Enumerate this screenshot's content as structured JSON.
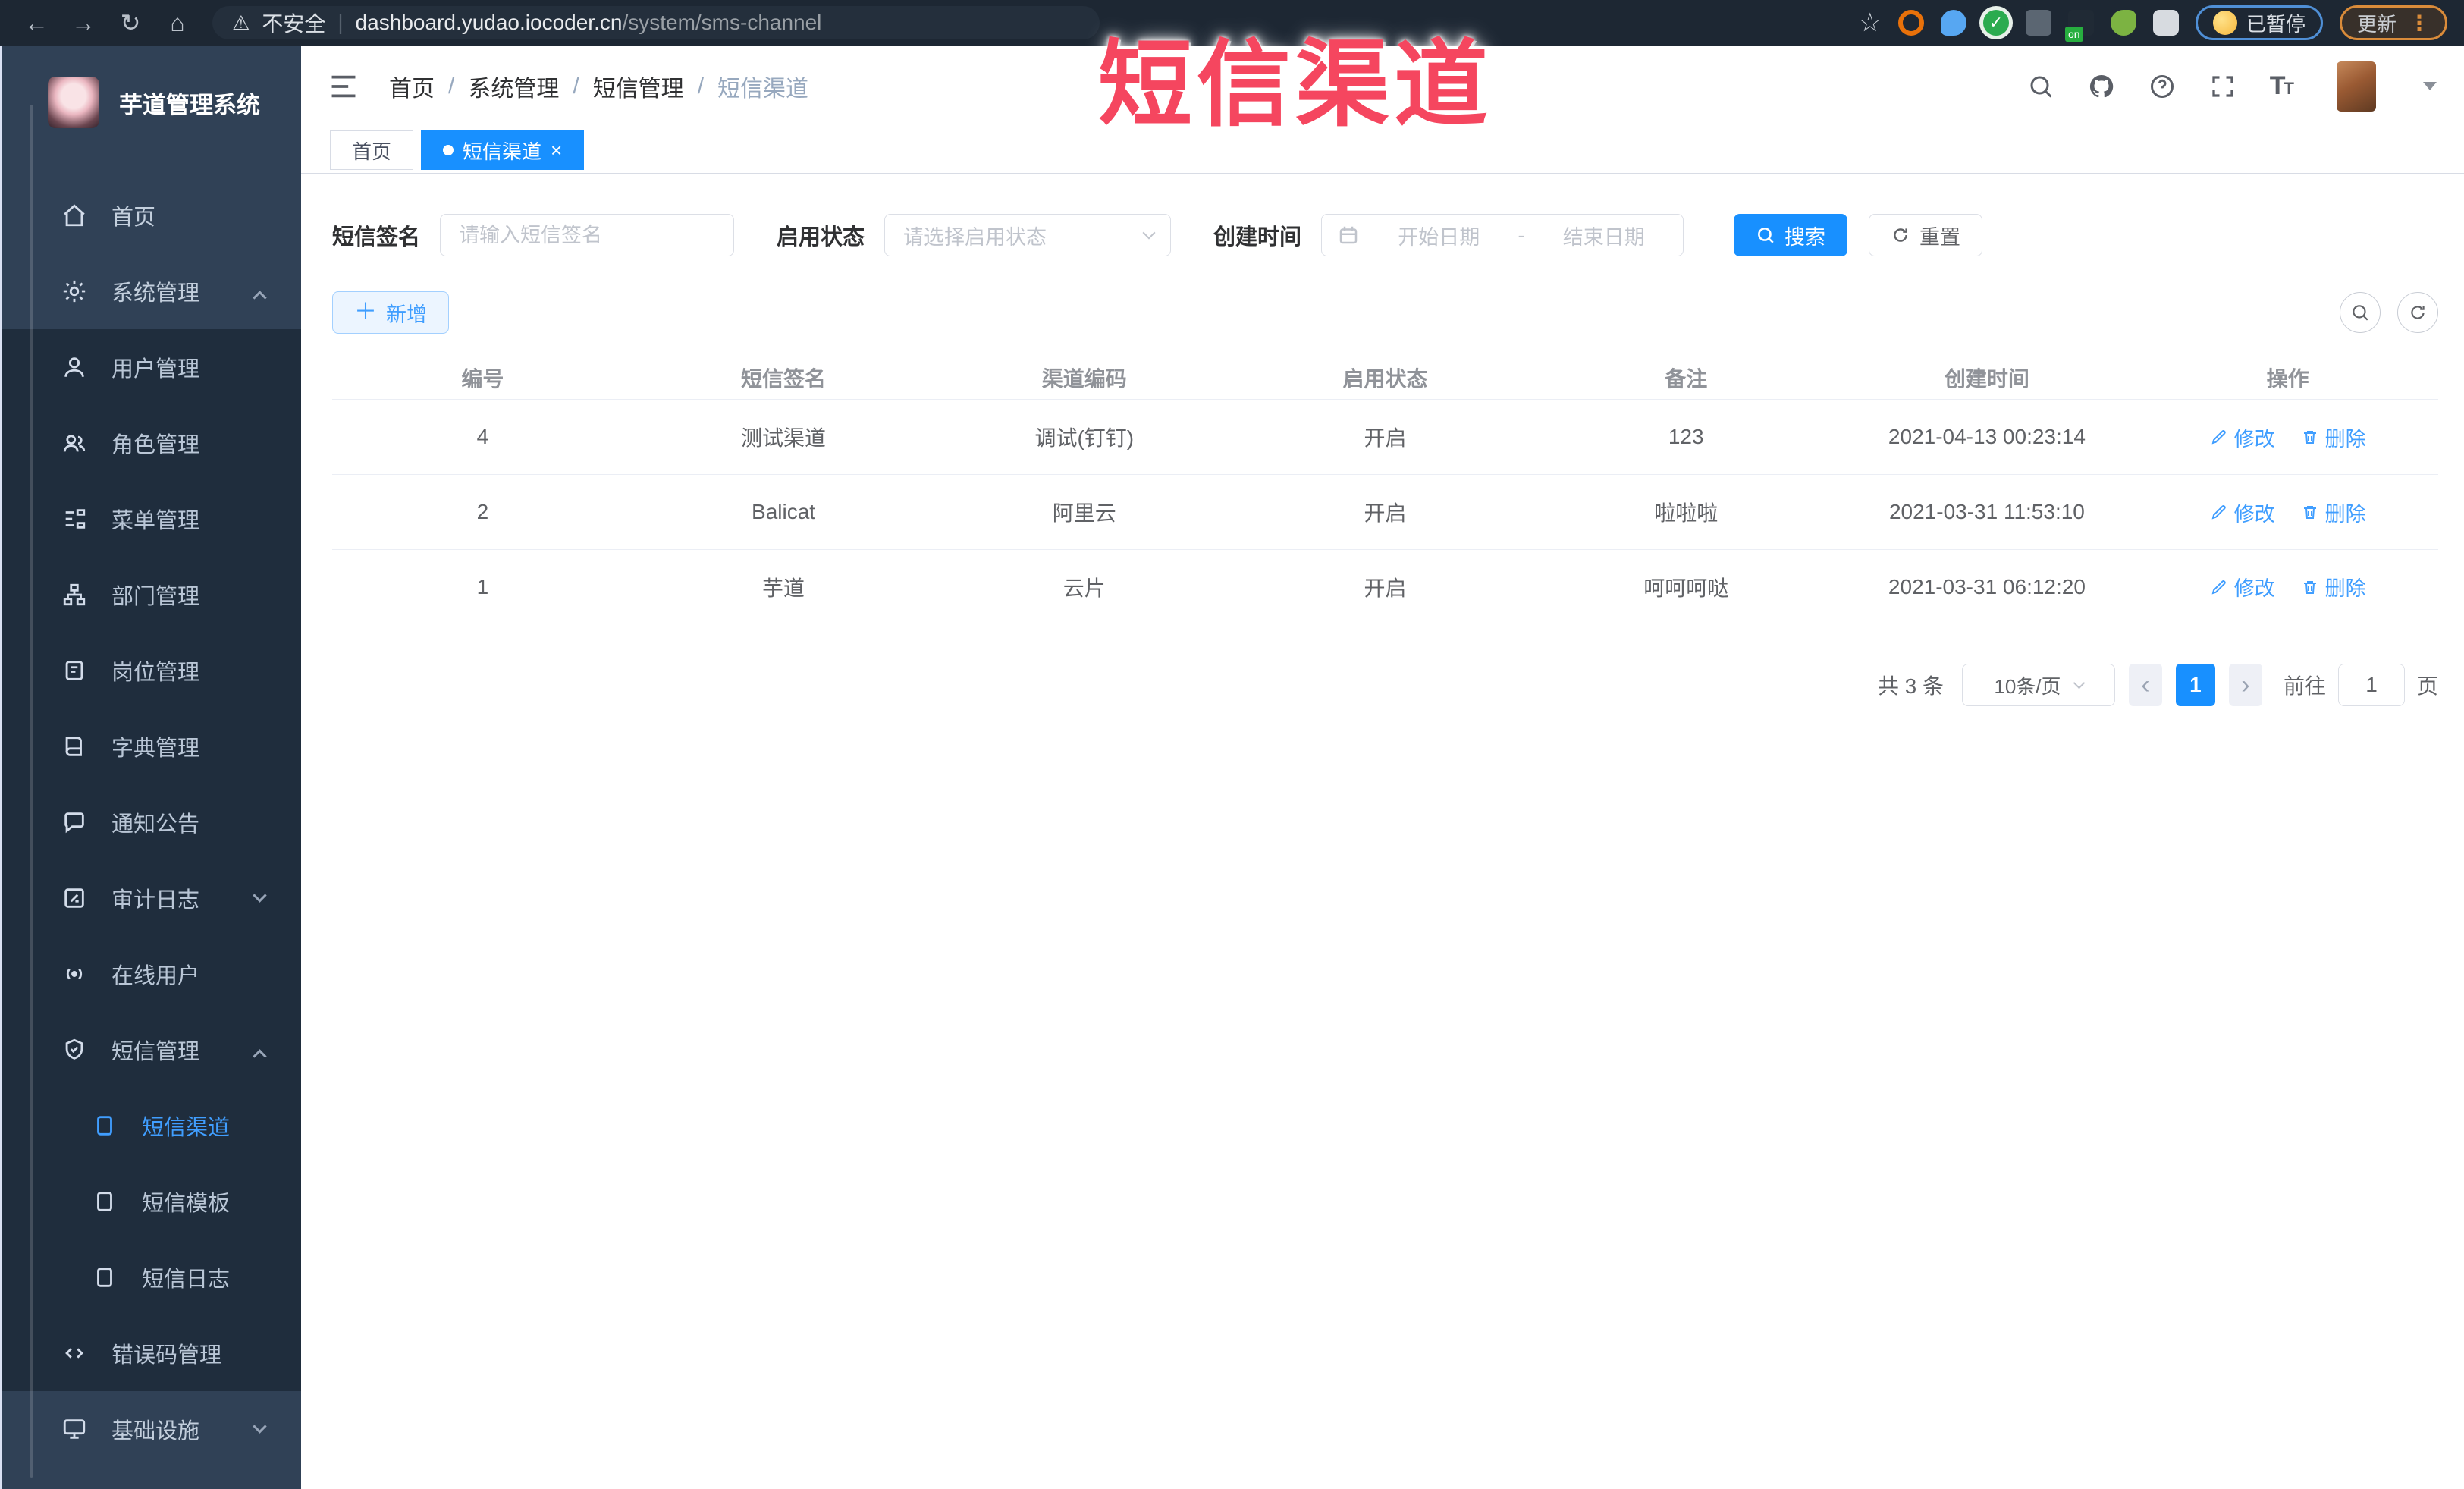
{
  "colors": {
    "accent": "#1890ff",
    "link": "#409eff",
    "sidebar_bg": "#304156",
    "submenu_bg": "#1f2d3d",
    "chrome_bg": "#1d2733",
    "overlay_red": "#f5465f"
  },
  "icons": {
    "back": "←",
    "forward": "→",
    "reload": "↻",
    "home": "⌂",
    "warning": "⚠",
    "star": "☆",
    "kebab": "⋮",
    "close": "×",
    "prev": "‹",
    "next": "›",
    "plus": "＋",
    "divider": "|",
    "dash": "-"
  },
  "browser": {
    "security_label": "不安全",
    "url_host": "dashboard.yudao.iocoder.cn",
    "url_path": "/system/sms-channel",
    "paused_label": "已暂停",
    "update_label": "更新"
  },
  "overlay": {
    "title": "短信渠道"
  },
  "sidebar": {
    "app_title": "芋道管理系统",
    "items": [
      {
        "label": "首页"
      },
      {
        "label": "系统管理"
      },
      {
        "label": "用户管理"
      },
      {
        "label": "角色管理"
      },
      {
        "label": "菜单管理"
      },
      {
        "label": "部门管理"
      },
      {
        "label": "岗位管理"
      },
      {
        "label": "字典管理"
      },
      {
        "label": "通知公告"
      },
      {
        "label": "审计日志"
      },
      {
        "label": "在线用户"
      },
      {
        "label": "短信管理"
      },
      {
        "label": "短信渠道"
      },
      {
        "label": "短信模板"
      },
      {
        "label": "短信日志"
      },
      {
        "label": "错误码管理"
      },
      {
        "label": "基础设施"
      }
    ]
  },
  "header": {
    "breadcrumb": [
      "首页",
      "系统管理",
      "短信管理",
      "短信渠道"
    ],
    "separator": "/"
  },
  "tabs": [
    {
      "label": "首页"
    },
    {
      "label": "短信渠道"
    }
  ],
  "filters": {
    "signature_label": "短信签名",
    "signature_placeholder": "请输入短信签名",
    "status_label": "启用状态",
    "status_placeholder": "请选择启用状态",
    "time_label": "创建时间",
    "start_placeholder": "开始日期",
    "end_placeholder": "结束日期",
    "search_label": "搜索",
    "reset_label": "重置"
  },
  "toolbar": {
    "add_label": "新增"
  },
  "table": {
    "columns": [
      "编号",
      "短信签名",
      "渠道编码",
      "启用状态",
      "备注",
      "创建时间",
      "操作"
    ],
    "rows": [
      {
        "id": "4",
        "signature": "测试渠道",
        "code": "调试(钉钉)",
        "status": "开启",
        "remark": "123",
        "created": "2021-04-13 00:23:14"
      },
      {
        "id": "2",
        "signature": "Balicat",
        "code": "阿里云",
        "status": "开启",
        "remark": "啦啦啦",
        "created": "2021-03-31 11:53:10"
      },
      {
        "id": "1",
        "signature": "芋道",
        "code": "云片",
        "status": "开启",
        "remark": "呵呵呵哒",
        "created": "2021-03-31 06:12:20"
      }
    ],
    "actions": {
      "edit": "修改",
      "delete": "删除"
    }
  },
  "pagination": {
    "total": "共 3 条",
    "page_size": "10条/页",
    "current": "1",
    "goto_label": "前往",
    "goto_value": "1",
    "unit_label": "页"
  }
}
